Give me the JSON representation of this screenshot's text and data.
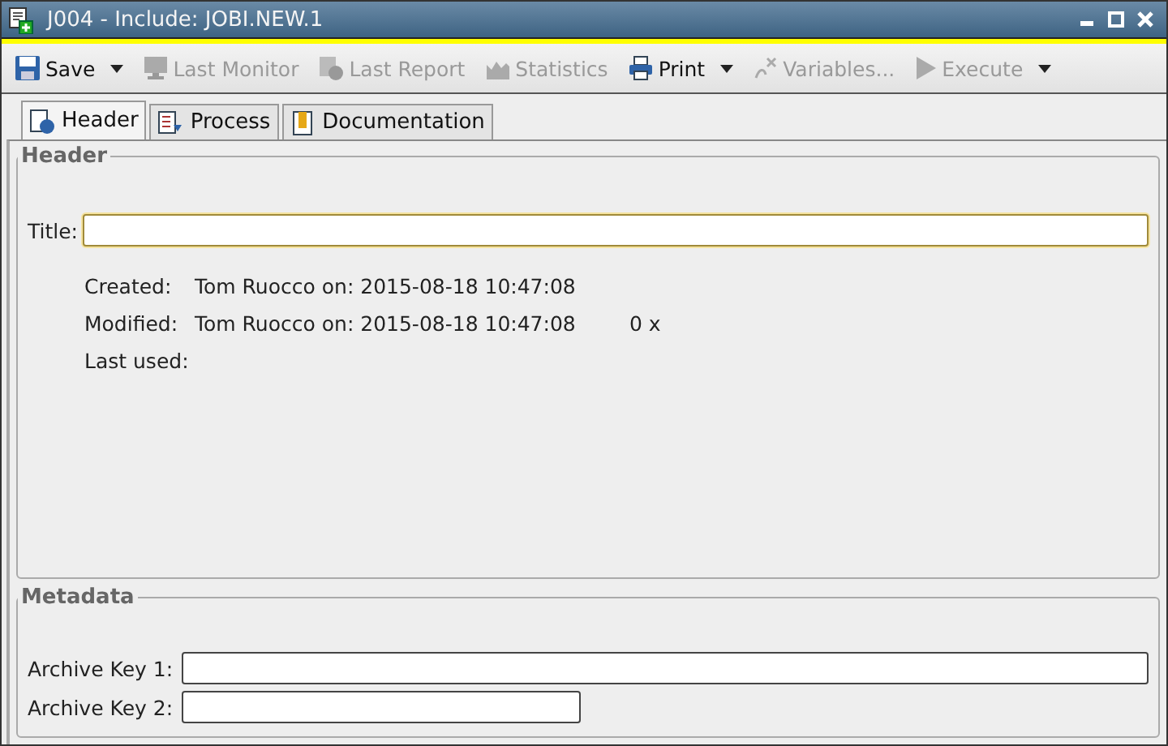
{
  "window": {
    "title": "J004 - Include: JOBI.NEW.1"
  },
  "toolbar": [
    {
      "label": "Save",
      "disabled": false,
      "dropdown": true
    },
    {
      "label": "Last Monitor",
      "disabled": true,
      "dropdown": false
    },
    {
      "label": "Last Report",
      "disabled": true,
      "dropdown": false
    },
    {
      "label": "Statistics",
      "disabled": true,
      "dropdown": false
    },
    {
      "label": "Print",
      "disabled": false,
      "dropdown": true
    },
    {
      "label": "Variables...",
      "disabled": true,
      "dropdown": false
    },
    {
      "label": "Execute",
      "disabled": true,
      "dropdown": true
    }
  ],
  "tabs": [
    {
      "label": "Header",
      "selected": true
    },
    {
      "label": "Process",
      "selected": false
    },
    {
      "label": "Documentation",
      "selected": false
    }
  ],
  "header": {
    "legend": "Header",
    "title_label": "Title:",
    "title_focused": true,
    "info": [
      {
        "label": "Created:",
        "value": "Tom Ruocco on: 2015-08-18 10:47:08"
      },
      {
        "label": "Modified:",
        "value": "Tom Ruocco on: 2015-08-18 10:47:08",
        "extra": "0 x"
      },
      {
        "label": "Last used:"
      }
    ]
  },
  "metadata": {
    "legend": "Metadata",
    "fields": [
      {
        "label": "Archive Key 1:",
        "wide": true
      },
      {
        "label": "Archive Key 2:",
        "wide": false
      }
    ]
  }
}
